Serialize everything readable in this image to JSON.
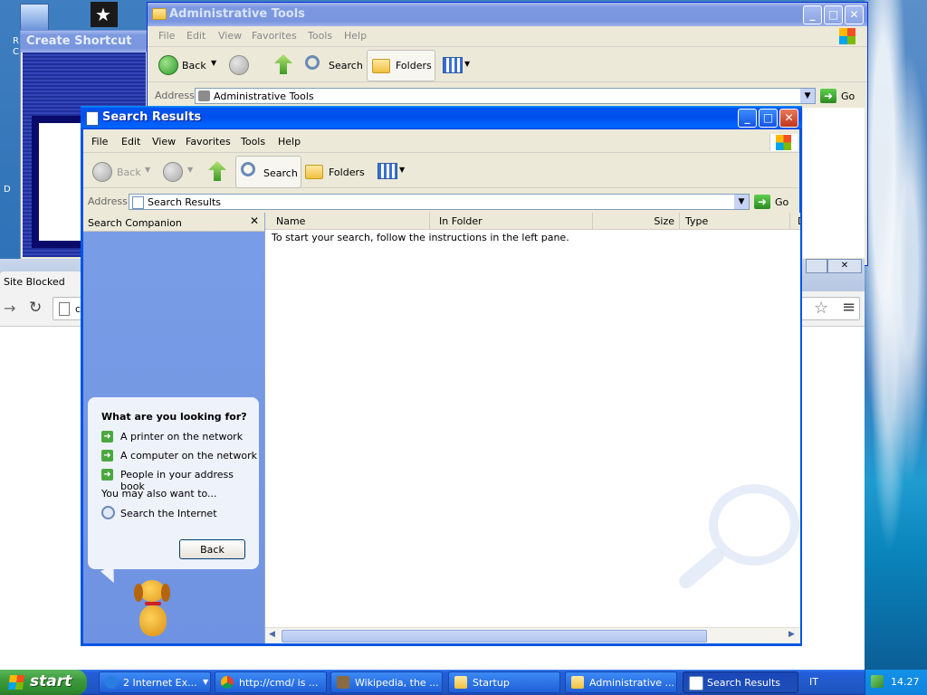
{
  "desktop": {
    "left_icon_letters": [
      "R",
      "C",
      "D"
    ]
  },
  "create_shortcut": {
    "title": "Create Shortcut"
  },
  "admin_tools": {
    "title": "Administrative Tools",
    "menu": [
      "File",
      "Edit",
      "View",
      "Favorites",
      "Tools",
      "Help"
    ],
    "toolbar": {
      "back": "Back",
      "search": "Search",
      "folders": "Folders"
    },
    "address_label": "Address",
    "address_value": "Administrative Tools",
    "go": "Go"
  },
  "chrome": {
    "tab_title": "Site Blocked",
    "url_fragment": "c"
  },
  "search_window": {
    "title": "Search Results",
    "menu": [
      "File",
      "Edit",
      "View",
      "Favorites",
      "Tools",
      "Help"
    ],
    "toolbar": {
      "back": "Back",
      "search": "Search",
      "folders": "Folders"
    },
    "address_label": "Address",
    "address_value": "Search Results",
    "go": "Go",
    "pane_title": "Search Companion",
    "columns": [
      "Name",
      "In Folder",
      "Size",
      "Type",
      "D"
    ],
    "empty_message": "To start your search, follow the instructions in the left pane.",
    "companion": {
      "question": "What are you looking for?",
      "options": [
        "A printer on the network",
        "A computer on the network",
        "People in your address book"
      ],
      "also": "You may also want to...",
      "internet": "Search the Internet",
      "back_button": "Back"
    }
  },
  "taskbar": {
    "start": "start",
    "tasks": [
      {
        "label": "2 Internet Ex...",
        "active": false
      },
      {
        "label": "http://cmd/ is ...",
        "active": false
      },
      {
        "label": "Wikipedia, the ...",
        "active": false
      },
      {
        "label": "Startup",
        "active": false
      },
      {
        "label": "Administrative ...",
        "active": false
      },
      {
        "label": "Search Results",
        "active": true
      }
    ],
    "language": "IT",
    "clock": "14.27"
  },
  "colors": {
    "xp_blue": "#0053ee",
    "taskpane_blue": "#7a9de6",
    "start_green": "#3c9a3c"
  }
}
